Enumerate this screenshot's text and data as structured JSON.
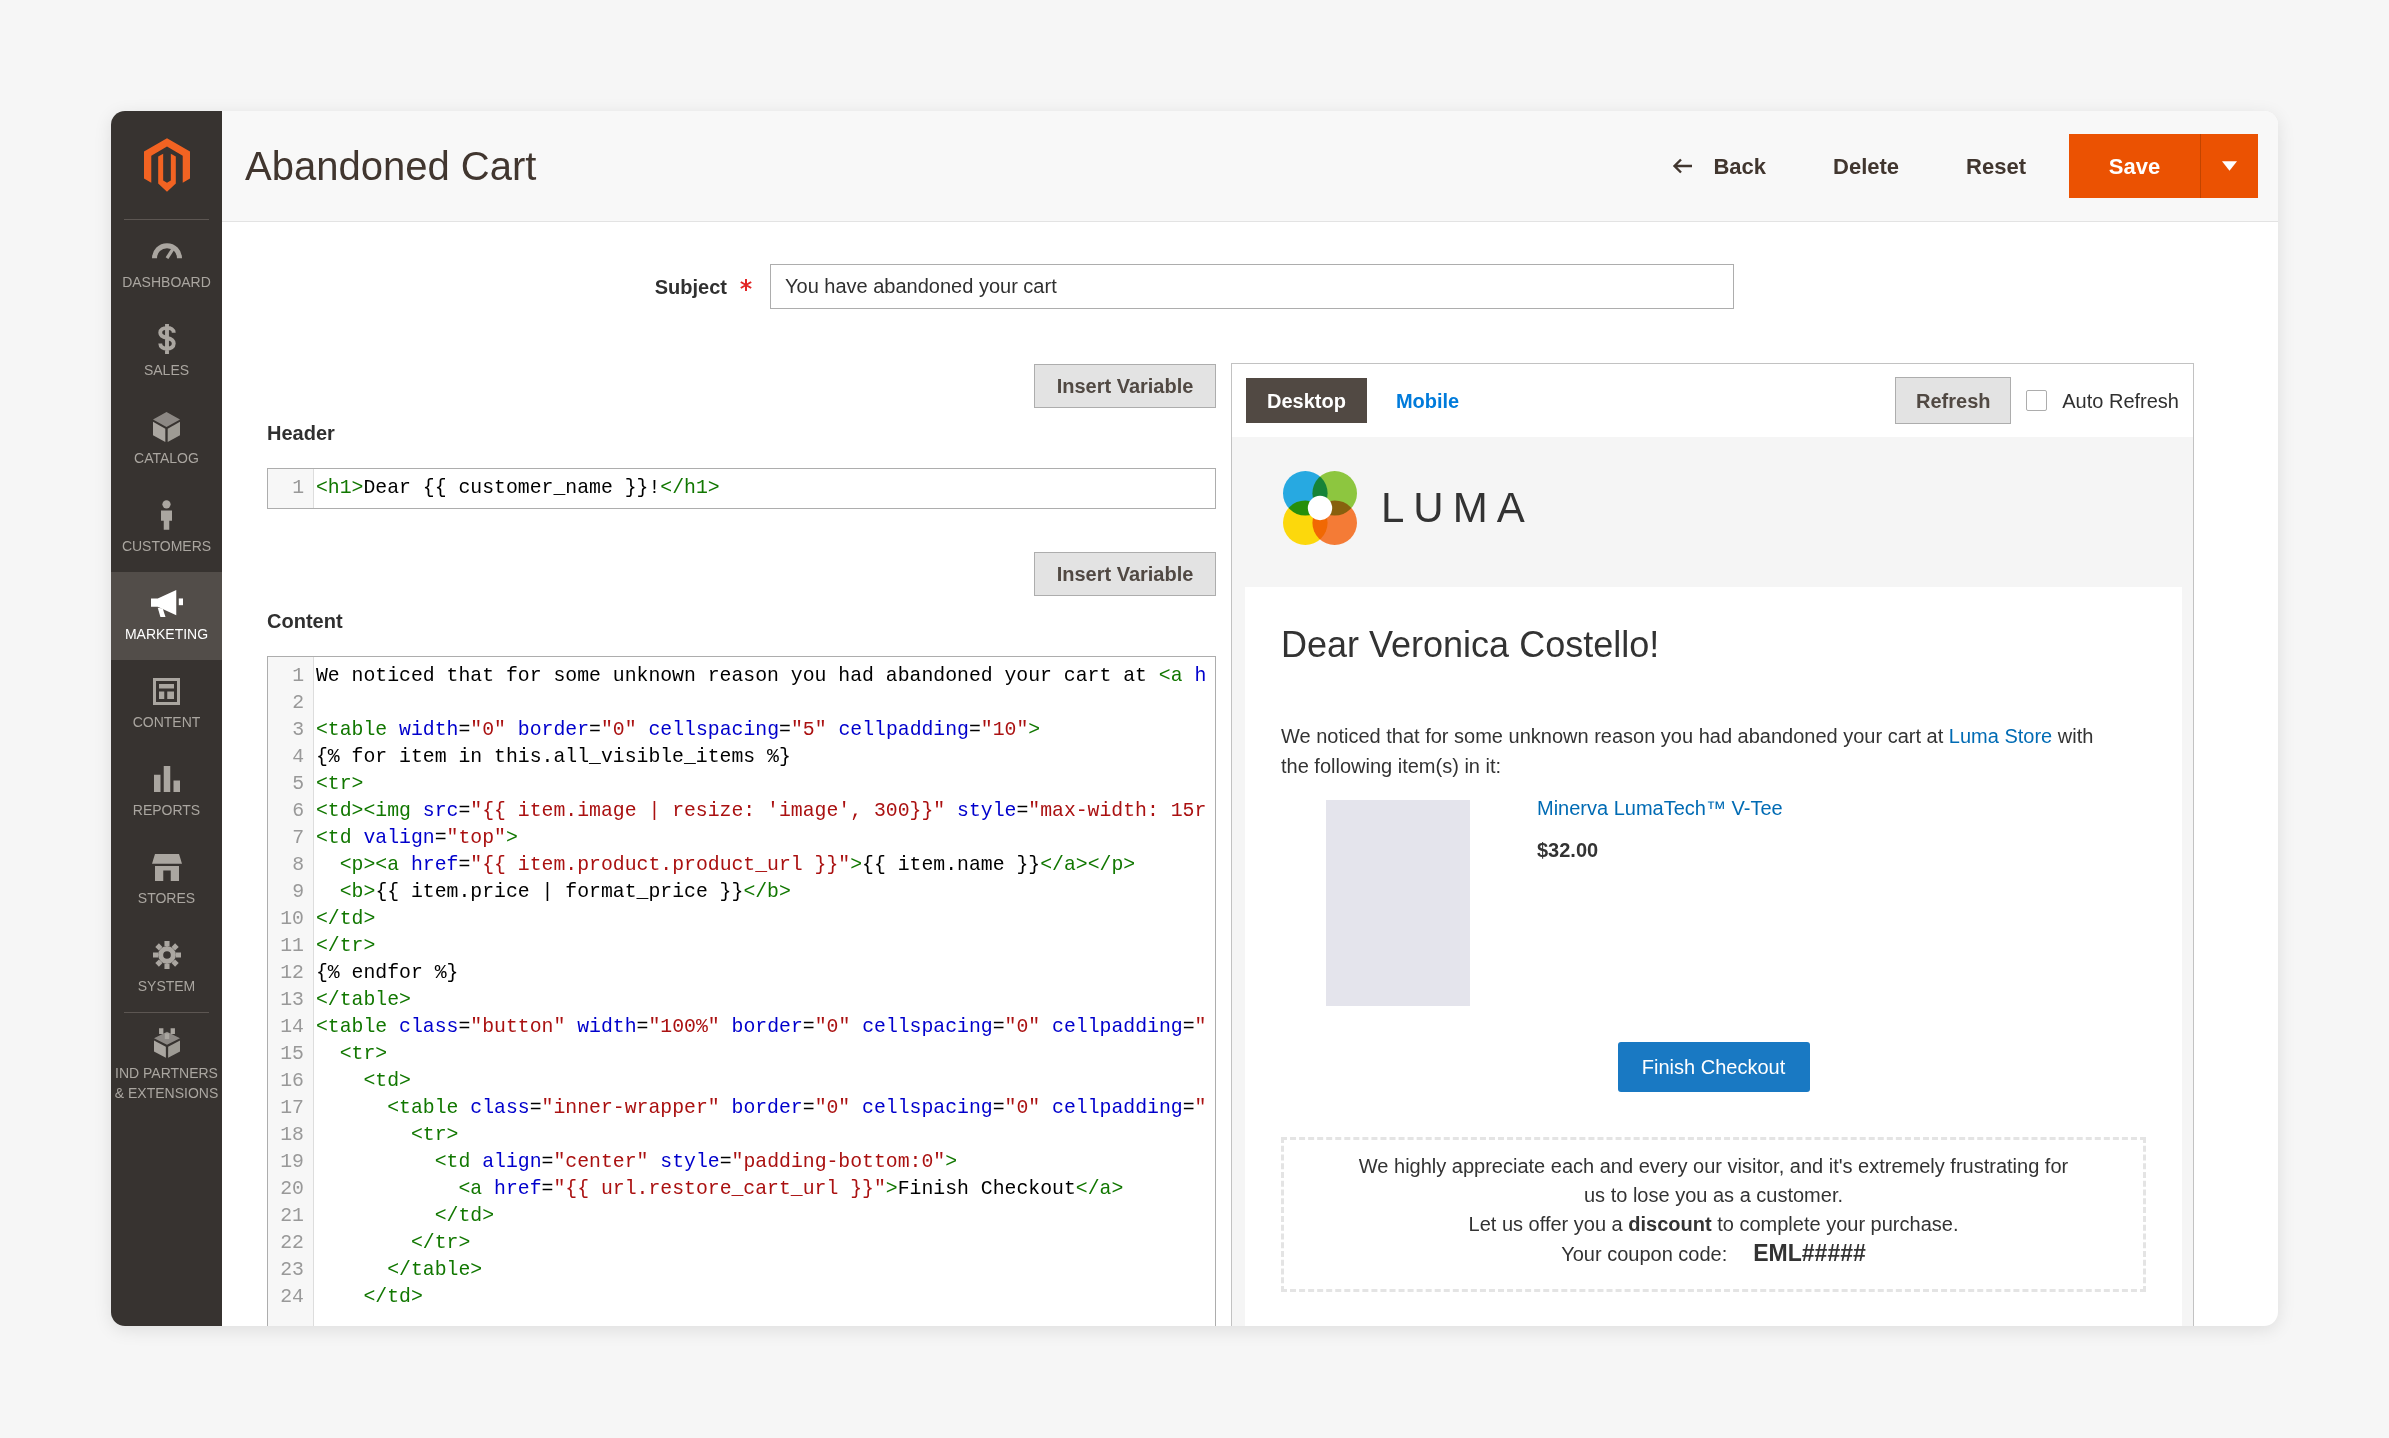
{
  "sidebar": {
    "items": [
      {
        "label": "DASHBOARD",
        "kind": "dashboard",
        "selected": false
      },
      {
        "label": "SALES",
        "kind": "sales",
        "selected": false
      },
      {
        "label": "CATALOG",
        "kind": "catalog",
        "selected": false
      },
      {
        "label": "CUSTOMERS",
        "kind": "customers",
        "selected": false
      },
      {
        "label": "MARKETING",
        "kind": "marketing",
        "selected": true
      },
      {
        "label": "CONTENT",
        "kind": "content",
        "selected": false
      },
      {
        "label": "REPORTS",
        "kind": "reports",
        "selected": false
      },
      {
        "label": "STORES",
        "kind": "stores",
        "selected": false
      },
      {
        "label": "SYSTEM",
        "kind": "system",
        "selected": false
      }
    ],
    "extensions": {
      "label": "IND PARTNERS & EXTENSIONS"
    }
  },
  "header": {
    "title": "Abandoned Cart",
    "actions": [
      {
        "label": "Back",
        "kind": "back"
      },
      {
        "label": "Delete",
        "kind": "delete"
      },
      {
        "label": "Reset",
        "kind": "reset"
      },
      {
        "label": "Save",
        "kind": "save"
      }
    ]
  },
  "subject": {
    "label": "Subject",
    "required": true,
    "value": "You have abandoned your cart"
  },
  "editors": [
    {
      "label": "Header",
      "button": "Insert Variable",
      "lines": [
        {
          "number": "1",
          "tokens": [
            {
              "kind": "tag",
              "text": "<h1>"
            },
            {
              "kind": "text",
              "text": "Dear {{ customer_name }}!"
            },
            {
              "kind": "tag",
              "text": "</h1>"
            }
          ]
        }
      ]
    },
    {
      "label": "Content",
      "button": "Insert Variable",
      "lines": [
        {
          "number": "1",
          "tokens": [
            {
              "kind": "text",
              "text": "We noticed that for some unknown reason you had abandoned your cart at "
            },
            {
              "kind": "tag",
              "text": "<a"
            },
            {
              "kind": "attr",
              "text": " h"
            }
          ]
        },
        {
          "number": "2"
        },
        {
          "number": "3",
          "tokens": [
            {
              "kind": "tag",
              "text": "<table"
            },
            {
              "kind": "attr",
              "text": " width"
            },
            {
              "kind": "text",
              "text": "="
            },
            {
              "kind": "string",
              "text": "\"0\""
            },
            {
              "kind": "attr",
              "text": " border"
            },
            {
              "kind": "text",
              "text": "="
            },
            {
              "kind": "string",
              "text": "\"0\""
            },
            {
              "kind": "attr",
              "text": " cellspacing"
            },
            {
              "kind": "text",
              "text": "="
            },
            {
              "kind": "string",
              "text": "\"5\""
            },
            {
              "kind": "attr",
              "text": " cellpadding"
            },
            {
              "kind": "text",
              "text": "="
            },
            {
              "kind": "string",
              "text": "\"10\""
            },
            {
              "kind": "tag",
              "text": ">"
            }
          ]
        },
        {
          "number": "4",
          "tokens": [
            {
              "kind": "text",
              "text": "{% for item in this.all_visible_items %}"
            }
          ]
        },
        {
          "number": "5",
          "tokens": [
            {
              "kind": "tag",
              "text": "<tr>"
            }
          ]
        },
        {
          "number": "6",
          "tokens": [
            {
              "kind": "tag",
              "text": "<td><img"
            },
            {
              "kind": "attr",
              "text": " src"
            },
            {
              "kind": "text",
              "text": "="
            },
            {
              "kind": "string",
              "text": "\"{{ item.image | resize: 'image', 300}}\""
            },
            {
              "kind": "attr",
              "text": " style"
            },
            {
              "kind": "text",
              "text": "="
            },
            {
              "kind": "string",
              "text": "\"max-width: 15r"
            }
          ]
        },
        {
          "number": "7",
          "tokens": [
            {
              "kind": "tag",
              "text": "<td"
            },
            {
              "kind": "attr",
              "text": " valign"
            },
            {
              "kind": "text",
              "text": "="
            },
            {
              "kind": "string",
              "text": "\"top\""
            },
            {
              "kind": "tag",
              "text": ">"
            }
          ]
        },
        {
          "number": "8",
          "tokens": [
            {
              "kind": "tag",
              "text": "  <p><a"
            },
            {
              "kind": "attr",
              "text": " href"
            },
            {
              "kind": "text",
              "text": "="
            },
            {
              "kind": "string",
              "text": "\"{{ item.product.product_url }}\""
            },
            {
              "kind": "tag",
              "text": ">"
            },
            {
              "kind": "text",
              "text": "{{ item.name }}"
            },
            {
              "kind": "tag",
              "text": "</a></p>"
            }
          ]
        },
        {
          "number": "9",
          "tokens": [
            {
              "kind": "tag",
              "text": "  <b>"
            },
            {
              "kind": "text",
              "text": "{{ item.price | format_price }}"
            },
            {
              "kind": "tag",
              "text": "</b>"
            }
          ]
        },
        {
          "number": "10",
          "tokens": [
            {
              "kind": "tag",
              "text": "</td>"
            }
          ]
        },
        {
          "number": "11",
          "tokens": [
            {
              "kind": "tag",
              "text": "</tr>"
            }
          ]
        },
        {
          "number": "12",
          "tokens": [
            {
              "kind": "text",
              "text": "{% endfor %}"
            }
          ]
        },
        {
          "number": "13",
          "tokens": [
            {
              "kind": "tag",
              "text": "</table>"
            }
          ]
        },
        {
          "number": "14",
          "tokens": [
            {
              "kind": "tag",
              "text": "<table"
            },
            {
              "kind": "attr",
              "text": " class"
            },
            {
              "kind": "text",
              "text": "="
            },
            {
              "kind": "string",
              "text": "\"button\""
            },
            {
              "kind": "attr",
              "text": " width"
            },
            {
              "kind": "text",
              "text": "="
            },
            {
              "kind": "string",
              "text": "\"100%\""
            },
            {
              "kind": "attr",
              "text": " border"
            },
            {
              "kind": "text",
              "text": "="
            },
            {
              "kind": "string",
              "text": "\"0\""
            },
            {
              "kind": "attr",
              "text": " cellspacing"
            },
            {
              "kind": "text",
              "text": "="
            },
            {
              "kind": "string",
              "text": "\"0\""
            },
            {
              "kind": "attr",
              "text": " cellpadding"
            },
            {
              "kind": "text",
              "text": "="
            },
            {
              "kind": "string",
              "text": "\""
            }
          ]
        },
        {
          "number": "15",
          "tokens": [
            {
              "kind": "tag",
              "text": "  <tr>"
            }
          ]
        },
        {
          "number": "16",
          "tokens": [
            {
              "kind": "tag",
              "text": "    <td>"
            }
          ]
        },
        {
          "number": "17",
          "tokens": [
            {
              "kind": "tag",
              "text": "      <table"
            },
            {
              "kind": "attr",
              "text": " class"
            },
            {
              "kind": "text",
              "text": "="
            },
            {
              "kind": "string",
              "text": "\"inner-wrapper\""
            },
            {
              "kind": "attr",
              "text": " border"
            },
            {
              "kind": "text",
              "text": "="
            },
            {
              "kind": "string",
              "text": "\"0\""
            },
            {
              "kind": "attr",
              "text": " cellspacing"
            },
            {
              "kind": "text",
              "text": "="
            },
            {
              "kind": "string",
              "text": "\"0\""
            },
            {
              "kind": "attr",
              "text": " cellpadding"
            },
            {
              "kind": "text",
              "text": "="
            },
            {
              "kind": "string",
              "text": "\""
            }
          ]
        },
        {
          "number": "18",
          "tokens": [
            {
              "kind": "tag",
              "text": "        <tr>"
            }
          ]
        },
        {
          "number": "19",
          "tokens": [
            {
              "kind": "tag",
              "text": "          <td"
            },
            {
              "kind": "attr",
              "text": " align"
            },
            {
              "kind": "text",
              "text": "="
            },
            {
              "kind": "string",
              "text": "\"center\""
            },
            {
              "kind": "attr",
              "text": " style"
            },
            {
              "kind": "text",
              "text": "="
            },
            {
              "kind": "string",
              "text": "\"padding-bottom:0\""
            },
            {
              "kind": "tag",
              "text": ">"
            }
          ]
        },
        {
          "number": "20",
          "tokens": [
            {
              "kind": "tag",
              "text": "            <a"
            },
            {
              "kind": "attr",
              "text": " href"
            },
            {
              "kind": "text",
              "text": "="
            },
            {
              "kind": "string",
              "text": "\"{{ url.restore_cart_url }}\""
            },
            {
              "kind": "tag",
              "text": ">"
            },
            {
              "kind": "text",
              "text": "Finish Checkout"
            },
            {
              "kind": "tag",
              "text": "</a>"
            }
          ]
        },
        {
          "number": "21",
          "tokens": [
            {
              "kind": "tag",
              "text": "          </td>"
            }
          ]
        },
        {
          "number": "22",
          "tokens": [
            {
              "kind": "tag",
              "text": "        </tr>"
            }
          ]
        },
        {
          "number": "23",
          "tokens": [
            {
              "kind": "tag",
              "text": "      </table>"
            }
          ]
        },
        {
          "number": "24",
          "tokens": [
            {
              "kind": "tag",
              "text": "    </td>"
            }
          ]
        }
      ]
    }
  ],
  "preview": {
    "tabs": [
      {
        "label": "Desktop",
        "selected": true
      },
      {
        "label": "Mobile",
        "selected": false
      }
    ],
    "refresh": "Refresh",
    "auto_refresh": {
      "label": "Auto Refresh",
      "checked": false
    },
    "email": {
      "brand": "LUMA",
      "greeting": "Dear Veronica Costello!",
      "intro": [
        {
          "kind": "text",
          "text": "We noticed that for some unknown reason you had abandoned your cart at "
        },
        {
          "kind": "link",
          "text": "Luma Store"
        },
        {
          "kind": "text",
          "text": " with the following item(s) in it:"
        }
      ],
      "items": [
        {
          "name": "Minerva LumaTech™ V-Tee",
          "price": "$32.00"
        }
      ],
      "button": "Finish Checkout",
      "coupon": {
        "message": "We highly appreciate each and every our visitor, and it's extremely frustrating for us to lose you as a customer.",
        "offer": "Let us offer you a **discount** to complete your purchase.",
        "code_label": "Your coupon code:",
        "code": "EML#####"
      }
    }
  }
}
